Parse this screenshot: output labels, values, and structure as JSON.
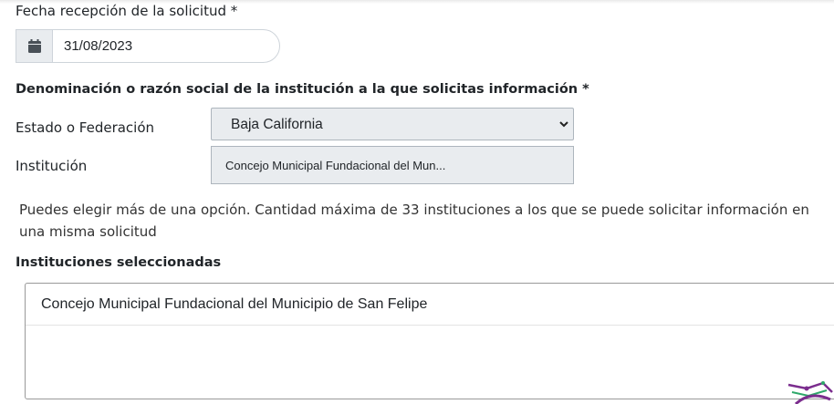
{
  "date_field": {
    "label": "Fecha recepción de la solicitud *",
    "icon": "calendar-icon",
    "value": "31/08/2023"
  },
  "institution_section": {
    "heading": "Denominación o razón social de la institución a la que solicitas información *",
    "state_label": "Estado o Federación",
    "state_value": "Baja California",
    "institution_label": "Institución",
    "institution_value": "Concejo Municipal Fundacional del Mun..."
  },
  "help_text": "Puedes elegir más de una opción. Cantidad máxima de 33 instituciones a los que se puede solicitar información en una misma solicitud",
  "selected": {
    "heading": "Instituciones seleccionadas",
    "items": [
      {
        "label": "Concejo Municipal Fundacional del Municipio de San Felipe"
      }
    ]
  },
  "colors": {
    "field_bg": "#e9ecef",
    "border": "#ced4da",
    "text": "#212529",
    "logo_purple": "#7b2d8e",
    "logo_green": "#2ea86a"
  }
}
